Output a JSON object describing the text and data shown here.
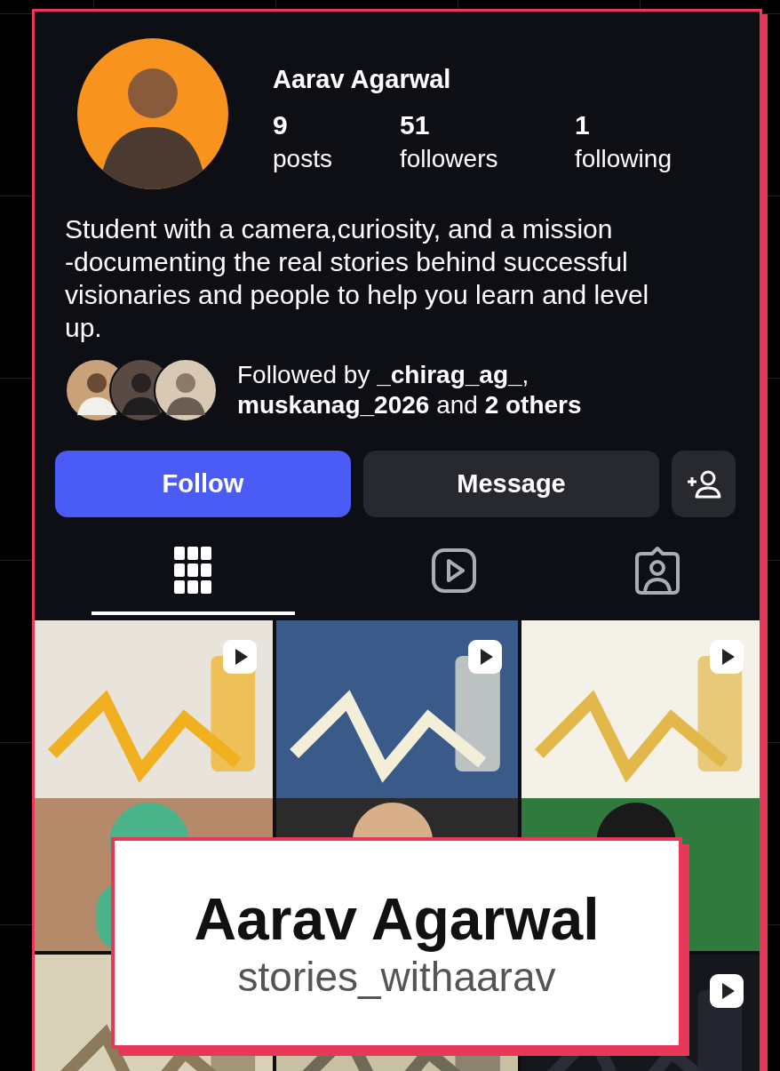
{
  "profile": {
    "name": "Aarav Agarwal",
    "stats": [
      {
        "value": "9",
        "label": "posts"
      },
      {
        "value": "51",
        "label": "followers"
      },
      {
        "value": "1",
        "label": "following"
      }
    ],
    "bio": "Student with a camera,curiosity, and a mission -documenting the real stories behind successful visionaries and people to help you learn and level up.",
    "followed_by": {
      "avatars": [
        {
          "kind": "avatar"
        },
        {
          "kind": "avatar"
        },
        {
          "kind": "avatar"
        }
      ],
      "text": "Followed by **_chirag_ag_**, **muskanag_2026** and **2 others**"
    }
  },
  "buttons": [
    {
      "kind": "primary",
      "label": "Follow"
    },
    {
      "kind": "secondary",
      "label": "Message"
    },
    {
      "kind": "icon"
    }
  ],
  "tabs": [
    {
      "kind": "grid",
      "selected": true
    },
    {
      "kind": "reels",
      "selected": false
    },
    {
      "kind": "tagged",
      "selected": false
    }
  ],
  "posts": [
    {
      "kind": "picture",
      "reel": true
    },
    {
      "kind": "picture",
      "reel": true
    },
    {
      "kind": "picture",
      "reel": true
    },
    {
      "kind": "picture"
    },
    {
      "kind": "picture"
    },
    {
      "kind": "picture",
      "reel": true
    }
  ],
  "name_card": {
    "title": "Aarav Agarwal",
    "handle": "stories_withaarav"
  }
}
